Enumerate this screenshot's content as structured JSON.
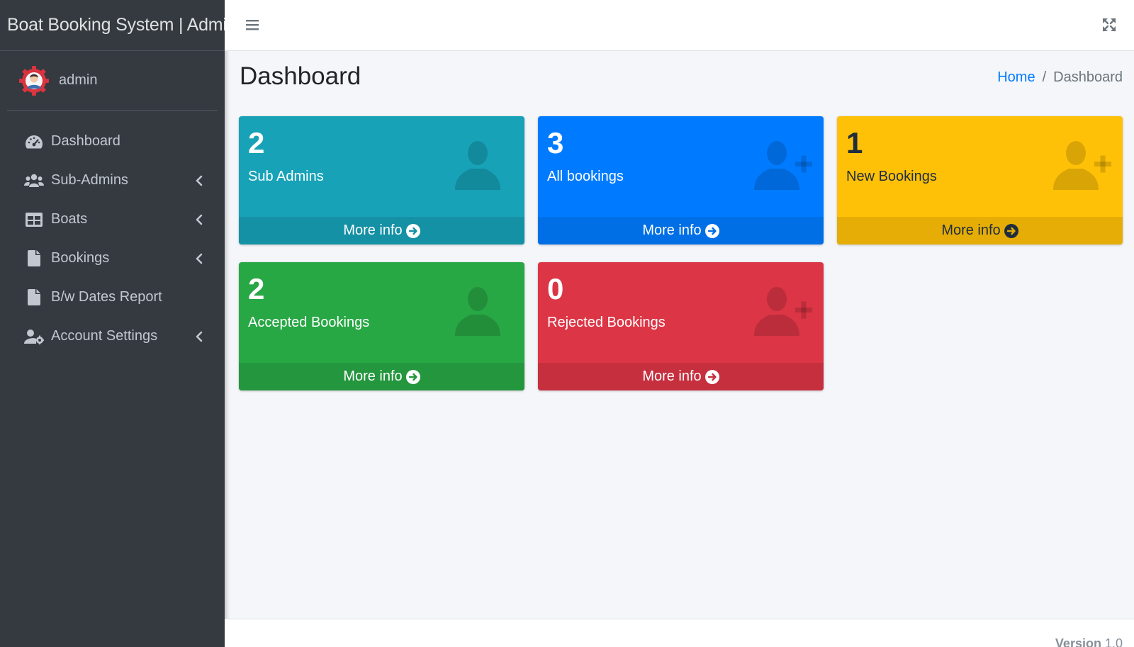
{
  "app": {
    "title": "Boat Booking System | Admin"
  },
  "user": {
    "name": "admin"
  },
  "sidebar": {
    "items": [
      {
        "label": "Dashboard",
        "icon": "tachometer-icon",
        "has_submenu": false
      },
      {
        "label": "Sub-Admins",
        "icon": "users-icon",
        "has_submenu": true
      },
      {
        "label": "Boats",
        "icon": "table-icon",
        "has_submenu": true
      },
      {
        "label": "Bookings",
        "icon": "file-icon",
        "has_submenu": true
      },
      {
        "label": "B/w Dates Report",
        "icon": "file-icon",
        "has_submenu": false
      },
      {
        "label": "Account Settings",
        "icon": "user-cog-icon",
        "has_submenu": true
      }
    ]
  },
  "header": {
    "page_title": "Dashboard",
    "breadcrumb": {
      "home": "Home",
      "separator": "/",
      "current": "Dashboard"
    }
  },
  "stats": [
    {
      "value": "2",
      "label": "Sub Admins",
      "link": "More info",
      "icon": "user-icon",
      "color": "#17a2b8"
    },
    {
      "value": "3",
      "label": "All bookings",
      "link": "More info",
      "icon": "user-plus-icon",
      "color": "#007bff"
    },
    {
      "value": "1",
      "label": "New Bookings",
      "link": "More info",
      "icon": "user-plus-icon",
      "color": "#ffc107"
    },
    {
      "value": "2",
      "label": "Accepted Bookings",
      "link": "More info",
      "icon": "user-icon",
      "color": "#28a745"
    },
    {
      "value": "0",
      "label": "Rejected Bookings",
      "link": "More info",
      "icon": "user-plus-icon",
      "color": "#dc3545"
    }
  ],
  "footer": {
    "version_label": "Version",
    "version_number": "1.0"
  }
}
